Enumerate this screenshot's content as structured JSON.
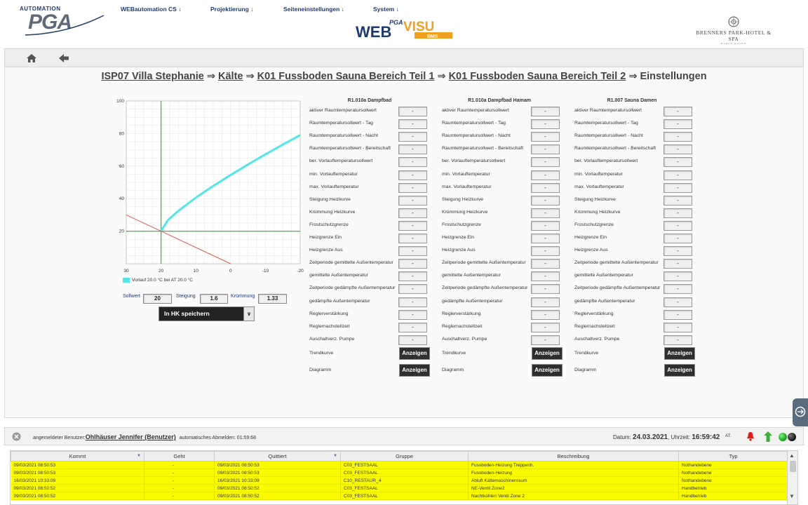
{
  "header": {
    "logo_top": "AUTOMATION",
    "logo_word": "PGA",
    "menu": [
      {
        "label": "WEBautomation CS ↓"
      },
      {
        "label": "Projektierung ↓"
      },
      {
        "label": "Seiteneinstellungen ↓"
      },
      {
        "label": "System ↓"
      }
    ],
    "center_logo": {
      "pga": "PGA",
      "web": "WEB",
      "visu": "VISU",
      "bms": "BMS"
    },
    "hotel": {
      "name": "BRENNERS PARK-HOTEL & SPA",
      "sub": "BADEN-BADEN"
    }
  },
  "breadcrumb": {
    "items": [
      "ISP07 Villa Stephanie",
      "Kälte",
      "K01 Fussboden Sauna Bereich Teil 1",
      "K01 Fussboden Sauna Bereich Teil 2"
    ],
    "separator": "⇒",
    "current": "Einstellungen"
  },
  "chart_data": {
    "type": "line",
    "x_ticks": [
      "30",
      "20",
      "10",
      "0",
      "-10",
      "-20"
    ],
    "y_ticks": [
      "100",
      "80",
      "60",
      "40",
      "20"
    ],
    "xlim": [
      30,
      -20
    ],
    "ylim": [
      0,
      100
    ],
    "series": [
      {
        "name": "Vorlauf 20.0 °C bei AT 20.0 °C",
        "color": "#52e6e6",
        "x": [
          20,
          18,
          15,
          10,
          5,
          0,
          -5,
          -10,
          -15,
          -20
        ],
        "y": [
          20,
          26.9,
          32.5,
          40.6,
          47.8,
          54.5,
          61,
          67.2,
          73.2,
          79
        ]
      },
      {
        "color": "#e0594f",
        "x": [
          30,
          20,
          0
        ],
        "y": [
          30,
          20,
          0
        ]
      }
    ],
    "vertical_line_x": 20,
    "horizontal_line_y": 20,
    "line_color": "#2fc42f",
    "grid": true,
    "legend": "bottom-left"
  },
  "chart_params": {
    "sollwert_label": "Sollwert",
    "sollwert": "20",
    "steigung_label": "Steigung",
    "steigung": "1.6",
    "kruemmung_label": "Krümmung",
    "kruemmung": "1.33"
  },
  "save_select": {
    "label": "In HK speichern",
    "arrow": "∨"
  },
  "columns": [
    {
      "title": "R1.010a Dampfbad"
    },
    {
      "title": "R1.010a Dampfbad Hamam"
    },
    {
      "title": "R1.007 Sauna Damen"
    }
  ],
  "rows": [
    {
      "label": "aktiver Raumtemperatursollwert",
      "value": "-"
    },
    {
      "label": "Raumtemperatursollwert - Tag",
      "value": "-"
    },
    {
      "label": "Raumtemperatursollwert - Nacht",
      "value": "-"
    },
    {
      "label": "Raumtemperatursollwert - Bereitschaft",
      "value": "-"
    },
    {
      "label": "ber. Vorlauftemperatursollwert",
      "value": "-"
    },
    {
      "label": "min. Vorlauftemperatur",
      "value": "-"
    },
    {
      "label": "max. Vorlauftemperatur",
      "value": "-"
    },
    {
      "label": "Steigung Heizkurve",
      "value": "-"
    },
    {
      "label": "Krümmung Heizkurve",
      "value": "-"
    },
    {
      "label": "Frostschutzgrenze",
      "value": "-"
    },
    {
      "label": "Heizgrenze Ein",
      "value": "-"
    },
    {
      "label": "Heizgrenze Aus",
      "value": "-"
    },
    {
      "label": "Zeitperiode gemittelte Außentemperatur",
      "value": "-"
    },
    {
      "label": "gemittelte Außentemperatur",
      "value": "-"
    },
    {
      "label": "Zeitperiode gedämpfte Außentemperatur",
      "value": "-"
    },
    {
      "label": "gedämpfte Außentemperatur",
      "value": "-"
    },
    {
      "label": "Reglerverstärkung",
      "value": "-"
    },
    {
      "label": "Reglernachstellzeit",
      "value": "-"
    },
    {
      "label": "Auschaltverz. Pumpe",
      "value": "-"
    }
  ],
  "action_rows": [
    {
      "label": "Trendkurve",
      "button": "Anzeigen"
    },
    {
      "label": "Diagramm",
      "button": "Anzeigen"
    }
  ],
  "status": {
    "user_prefix": "angemeldeter Benutzer:",
    "user_name": "Ohlhäuser Jennifer (Benutzer)",
    "logout_label": "automatisches Abmelden: 01:59:68",
    "date_label": "Datum:",
    "date": "24.03.2021",
    "time_label": ", Uhrzeit:",
    "time": "16:59:42",
    "at": "AT:"
  },
  "alarm_table": {
    "headers": [
      "Kommt",
      "Geht",
      "Quittiert",
      "Gruppe",
      "Beschreibung",
      "Typ"
    ],
    "rows": [
      [
        "09/03/2021 08:50:53",
        "-",
        "09/03/2021 08:50:53",
        "C03_FESTSAAL",
        "Fussboden-Heizung Treppenh.",
        "Nothandebene"
      ],
      [
        "09/03/2021 08:50:53",
        "-",
        "09/03/2021 08:50:53",
        "C03_FESTSAAL",
        "Fussboden-Heizung",
        "Nothandebene"
      ],
      [
        "16/03/2021 10:33:09",
        "-",
        "16/03/2021 10:33:09",
        "C10_RESTAUR_4",
        "Abluft Kältemaschinenraum",
        "Nothandebene"
      ],
      [
        "09/03/2021 08:50:52",
        "-",
        "09/03/2021 08:50:52",
        "C03_FESTSAAL",
        "NE-Ventil Zone2",
        "Handbetrieb"
      ],
      [
        "09/03/2021 08:50:52",
        "-",
        "09/03/2021 08:50:52",
        "C03_FESTSAAL",
        "Nachtkühlen Ventil Zone 2",
        "Handbetrieb"
      ]
    ]
  }
}
